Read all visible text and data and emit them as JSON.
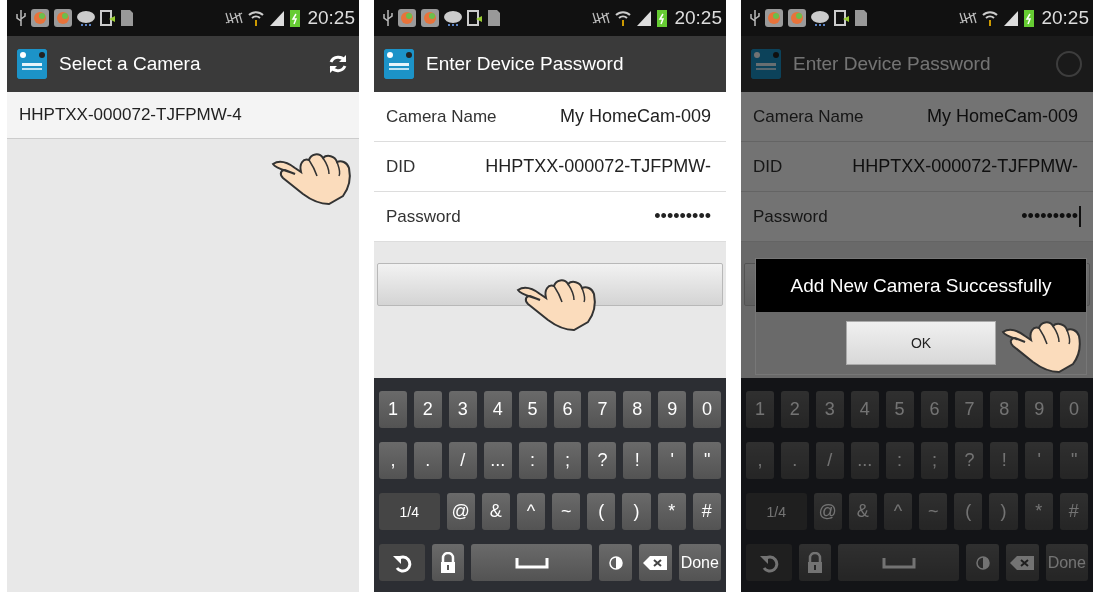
{
  "screens": [
    {
      "kind": "list",
      "dimmed": false,
      "status_bar": {
        "time": "20:25"
      },
      "action_bar": {
        "title": "Select a Camera",
        "refresh_button": true
      },
      "items": [
        {
          "label": "HHPTXX-000072-TJFPMW-4"
        }
      ]
    },
    {
      "kind": "form",
      "dimmed": false,
      "status_bar": {
        "time": "20:25"
      },
      "action_bar": {
        "title": "Enter Device Password"
      },
      "fields": [
        {
          "label": "Camera Name",
          "value": "My HomeCam-009",
          "focused": false
        },
        {
          "label": "DID",
          "value": "HHPTXX-000072-TJFPMW-",
          "focused": false
        },
        {
          "label": "Password",
          "value": "•••••••••",
          "focused": false
        }
      ],
      "keyboard": {
        "number_keys": [
          "1",
          "2",
          "3",
          "4",
          "5",
          "6",
          "7",
          "8",
          "9",
          "0"
        ],
        "punctuation_keys": [
          ",",
          ".",
          "/",
          "...",
          ":",
          ";",
          "?",
          "!",
          "'",
          "\""
        ],
        "page_key": "1/4",
        "symbol_keys": [
          "@",
          "&",
          "^",
          "~",
          "(",
          ")",
          "*",
          "#"
        ],
        "bottom_row": [
          {
            "kind": "undo"
          },
          {
            "kind": "lock"
          },
          {
            "kind": "space"
          },
          {
            "kind": "contrast"
          },
          {
            "kind": "backspace"
          },
          {
            "kind": "text",
            "label": "Done"
          }
        ]
      }
    },
    {
      "kind": "form",
      "dimmed": true,
      "status_bar": {
        "time": "20:25"
      },
      "action_bar": {
        "title": "Enter Device Password",
        "loading": true
      },
      "fields": [
        {
          "label": "Camera Name",
          "value": "My HomeCam-009",
          "focused": false
        },
        {
          "label": "DID",
          "value": "HHPTXX-000072-TJFPMW-",
          "focused": false
        },
        {
          "label": "Password",
          "value": "•••••••••",
          "focused": true
        }
      ],
      "keyboard": {
        "number_keys": [
          "1",
          "2",
          "3",
          "4",
          "5",
          "6",
          "7",
          "8",
          "9",
          "0"
        ],
        "punctuation_keys": [
          ",",
          ".",
          "/",
          "...",
          ":",
          ";",
          "?",
          "!",
          "'",
          "\""
        ],
        "page_key": "1/4",
        "symbol_keys": [
          "@",
          "&",
          "^",
          "~",
          "(",
          ")",
          "*",
          "#"
        ],
        "bottom_row": [
          {
            "kind": "undo"
          },
          {
            "kind": "lock"
          },
          {
            "kind": "space"
          },
          {
            "kind": "contrast"
          },
          {
            "kind": "backspace"
          },
          {
            "kind": "text",
            "label": "Done"
          }
        ]
      },
      "dialog": {
        "message": "Add New Camera Successfully",
        "button": "OK"
      }
    }
  ]
}
